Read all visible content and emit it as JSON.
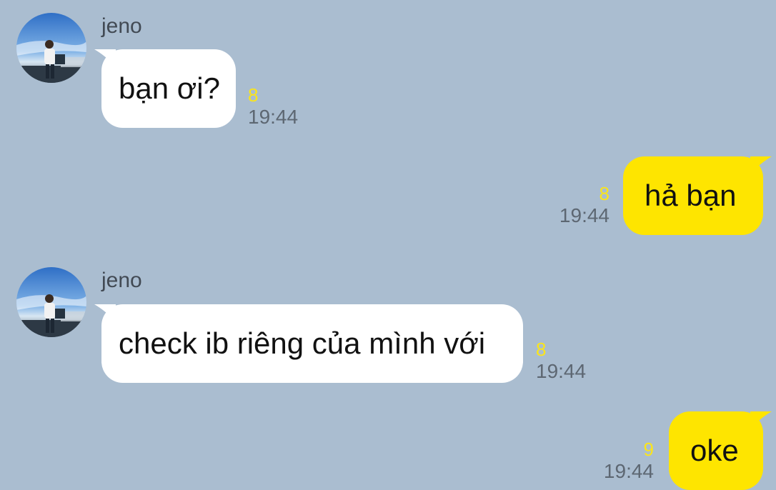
{
  "colors": {
    "background": "#aabdd0",
    "incoming_bubble": "#ffffff",
    "outgoing_bubble": "#fee500",
    "unread_count": "#fbe51a",
    "timestamp": "#5d6772"
  },
  "messages": [
    {
      "direction": "incoming",
      "sender": "jeno",
      "avatar_icon": "profile-photo-avatar",
      "text": "bạn ơi?",
      "unread": "8",
      "time": "19:44"
    },
    {
      "direction": "outgoing",
      "text": "hả bạn",
      "unread": "8",
      "time": "19:44"
    },
    {
      "direction": "incoming",
      "sender": "jeno",
      "avatar_icon": "profile-photo-avatar",
      "text": "check ib riêng của mình với",
      "unread": "8",
      "time": "19:44"
    },
    {
      "direction": "outgoing",
      "text": "oke",
      "unread": "9",
      "time": "19:44"
    }
  ]
}
